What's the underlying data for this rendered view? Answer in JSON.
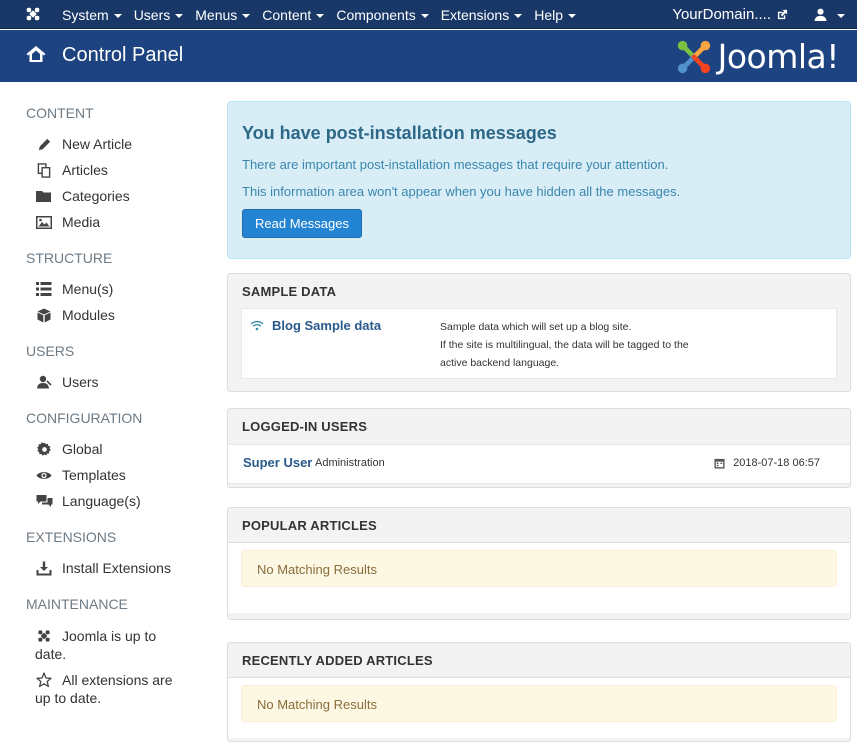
{
  "topnav": {
    "menus": [
      "System",
      "Users",
      "Menus",
      "Content",
      "Components",
      "Extensions",
      "Help"
    ],
    "site_name": "YourDomain....",
    "icons": {
      "logo": "joomla-icon",
      "external": "external-link-icon",
      "user": "user-icon"
    }
  },
  "header": {
    "title": "Control Panel",
    "brand": "Joomla!"
  },
  "sidebar": {
    "content_heading": "CONTENT",
    "new_article": "New Article",
    "articles": "Articles",
    "categories": "Categories",
    "media": "Media",
    "structure_heading": "STRUCTURE",
    "menus": "Menu(s)",
    "modules": "Modules",
    "users_heading": "USERS",
    "users": "Users",
    "configuration_heading": "CONFIGURATION",
    "global": "Global",
    "templates": "Templates",
    "languages": "Language(s)",
    "extensions_heading": "EXTENSIONS",
    "install_extensions": "Install Extensions",
    "maintenance_heading": "MAINTENANCE",
    "joomla_status": "Joomla is up to date.",
    "extensions_status": "All extensions are up to date."
  },
  "postinstall": {
    "title": "You have post-installation messages",
    "line1": "There are important post-installation messages that require your attention.",
    "line2": "This information area won't appear when you have hidden all the messages.",
    "button": "Read Messages"
  },
  "sample_data": {
    "heading": "SAMPLE DATA",
    "link": "Blog Sample data",
    "desc1": "Sample data which will set up a blog site.",
    "desc2": "If the site is multilingual, the data will be tagged to the",
    "desc3": "active backend language."
  },
  "logged_in": {
    "heading": "LOGGED-IN USERS",
    "name": "Super User",
    "role": "Administration",
    "date": "2018-07-18 06:57"
  },
  "popular": {
    "heading": "POPULAR ARTICLES",
    "empty": "No Matching Results"
  },
  "recent": {
    "heading": "RECENTLY ADDED ARTICLES",
    "empty": "No Matching Results"
  }
}
